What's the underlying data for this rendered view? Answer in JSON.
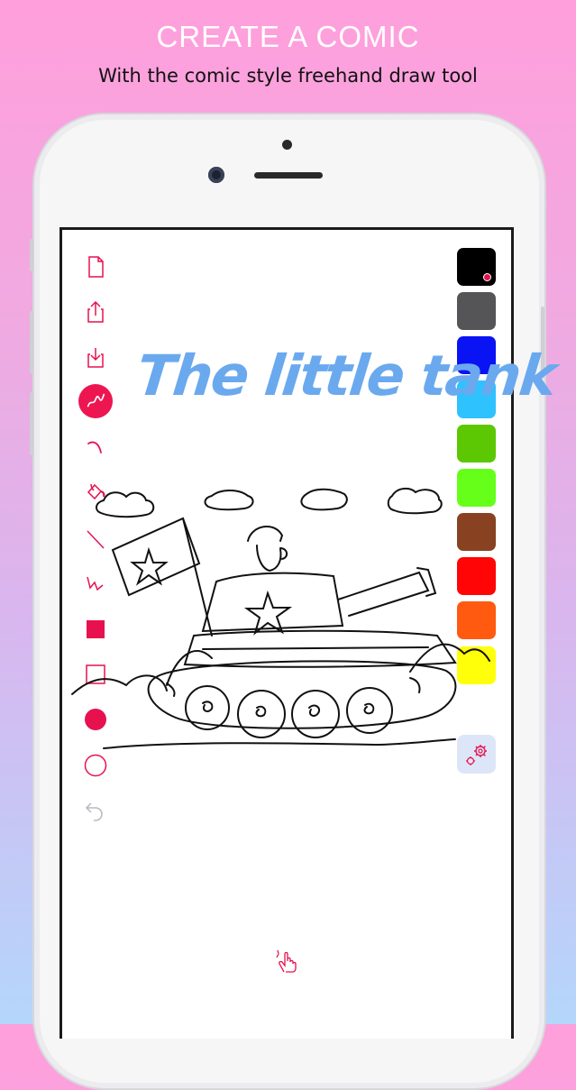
{
  "header": {
    "title": "CREATE A COMIC",
    "subtitle": "With the comic style freehand draw tool"
  },
  "canvas": {
    "drawing_title": "The little tank"
  },
  "toolbar": {
    "tools": [
      {
        "name": "new-page",
        "icon": "new-page-icon"
      },
      {
        "name": "export",
        "icon": "share-icon"
      },
      {
        "name": "import",
        "icon": "import-icon"
      },
      {
        "name": "freehand-pen",
        "icon": "squiggle-pen-icon",
        "selected": true
      },
      {
        "name": "curve",
        "icon": "curve-icon"
      },
      {
        "name": "fill",
        "icon": "paint-bucket-icon"
      },
      {
        "name": "line",
        "icon": "line-icon"
      },
      {
        "name": "zigzag",
        "icon": "zigzag-icon"
      },
      {
        "name": "filled-square",
        "icon": "filled-square-icon"
      },
      {
        "name": "square",
        "icon": "square-outline-icon"
      },
      {
        "name": "filled-circle",
        "icon": "filled-circle-icon"
      },
      {
        "name": "circle",
        "icon": "circle-outline-icon"
      },
      {
        "name": "undo",
        "icon": "undo-icon"
      }
    ],
    "accent_color": "#ed1651"
  },
  "palette": {
    "colors": [
      "#000000",
      "#555558",
      "#0a13f3",
      "#2ec2ff",
      "#5cc703",
      "#66ff1a",
      "#884222",
      "#ff0505",
      "#ff5a0f",
      "#ffff0a"
    ],
    "selected_index": 0
  },
  "bottom": {
    "icon": "touch-hand-icon"
  }
}
